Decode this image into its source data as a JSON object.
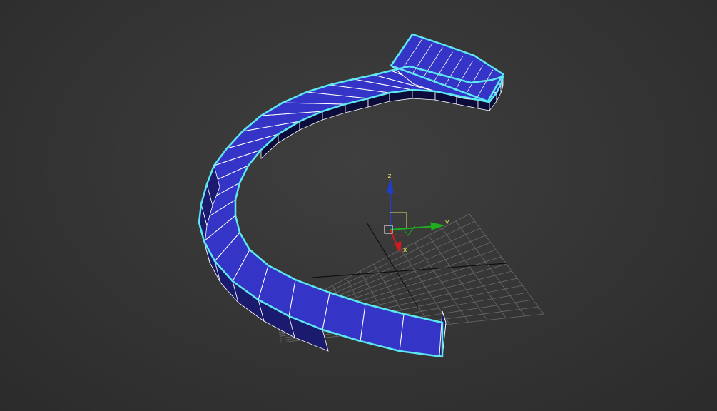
{
  "viewport": {
    "background_top": "#3f3f3f",
    "background_bottom": "#2b2b2b"
  },
  "object": {
    "type": "curved box spline sweep",
    "face_color": "#3434c6",
    "side_color": "#1a1a6e",
    "edge_color": "#ffffff",
    "selection_outline_color": "#5ce8f0",
    "selected": true
  },
  "grid": {
    "color": "#6a6a6a",
    "axis_color": "#101010"
  },
  "gizmo": {
    "x_label": "x",
    "y_label": "y",
    "z_label": "z",
    "x_color": "#d11b1b",
    "y_color": "#1fae1f",
    "z_color": "#1d3fcf",
    "plane_color": "#e0e060"
  }
}
